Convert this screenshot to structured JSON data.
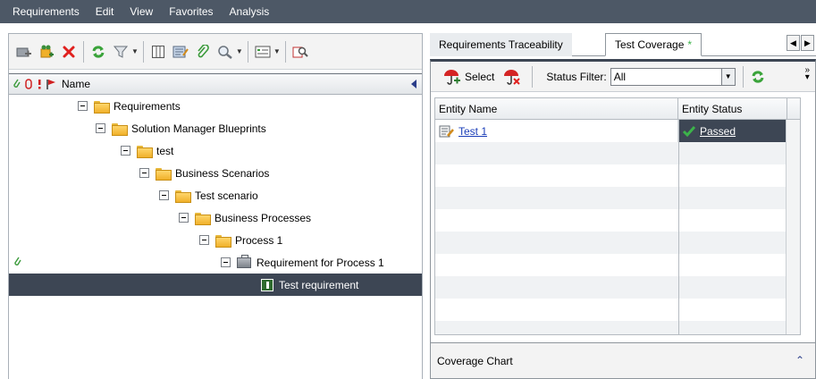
{
  "menu": [
    "Requirements",
    "Edit",
    "View",
    "Favorites",
    "Analysis"
  ],
  "tree_header": {
    "name_label": "Name"
  },
  "tree": [
    {
      "label": "Requirements",
      "type": "folder",
      "level": 0
    },
    {
      "label": "Solution Manager Blueprints",
      "type": "folder",
      "level": 1
    },
    {
      "label": "test",
      "type": "folder",
      "level": 2
    },
    {
      "label": "Business Scenarios",
      "type": "folder",
      "level": 3
    },
    {
      "label": "Test scenario",
      "type": "folder",
      "level": 4
    },
    {
      "label": "Business Processes",
      "type": "folder",
      "level": 5
    },
    {
      "label": "Process 1",
      "type": "folder",
      "level": 6
    },
    {
      "label": "Requirement for Process 1",
      "type": "requirement",
      "level": 7,
      "has_attachment": true
    },
    {
      "label": "Test requirement",
      "type": "test-requirement",
      "level": 8,
      "selected": true
    }
  ],
  "tabs": [
    {
      "label": "Requirements Traceability",
      "active": false
    },
    {
      "label": "Test Coverage",
      "active": true,
      "marker": "*"
    }
  ],
  "coverage": {
    "select_label": "Select",
    "status_filter_label": "Status Filter:",
    "status_filter_value": "All",
    "columns": [
      "Entity Name",
      "Entity Status"
    ],
    "rows": [
      {
        "name": "Test 1",
        "status": "Passed"
      }
    ],
    "footer_label": "Coverage Chart"
  },
  "colors": {
    "menu_bg": "#4d5866",
    "selection_bg": "#3d4654",
    "link": "#1a3db8",
    "passed_check": "#3cb34a"
  }
}
